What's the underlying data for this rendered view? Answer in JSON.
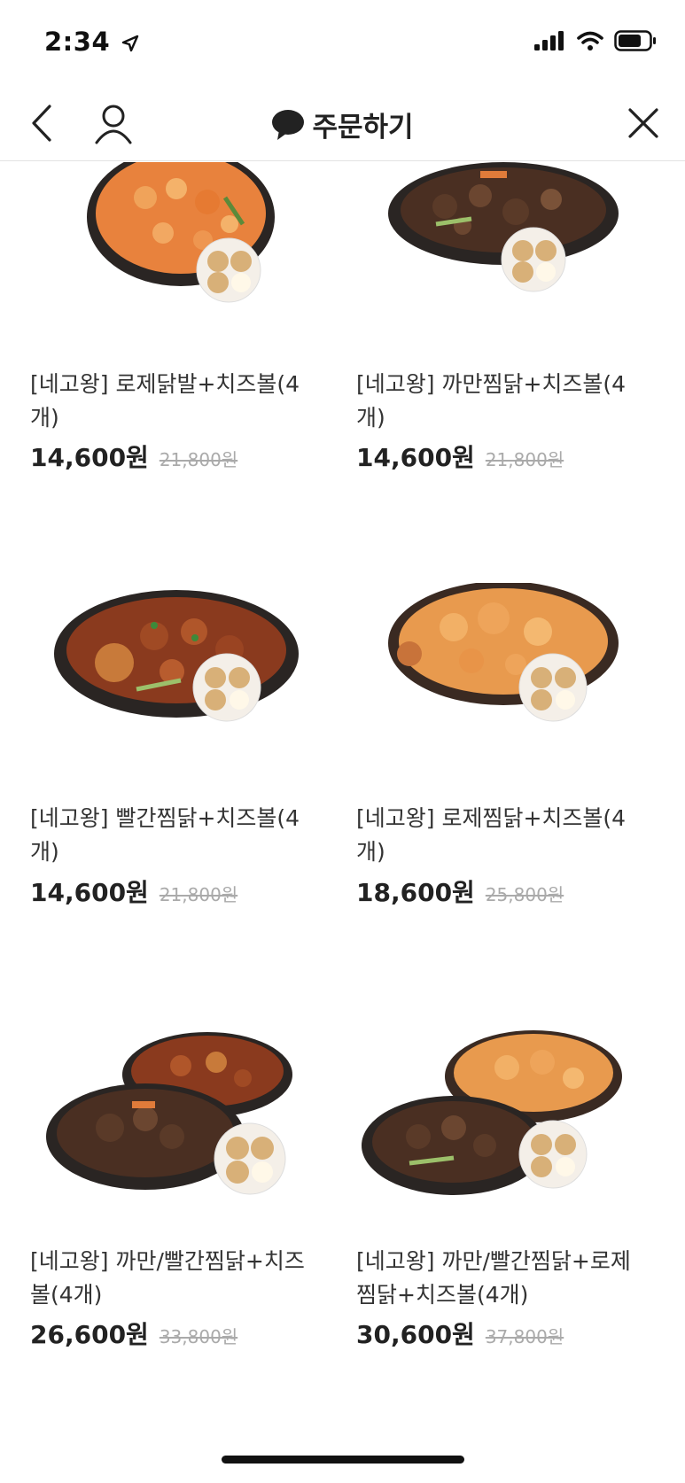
{
  "status": {
    "time": "2:34"
  },
  "nav": {
    "title": "주문하기"
  },
  "products": [
    {
      "name": "[네고왕] 로제닭발+치즈볼(4개)",
      "price": "14,600원",
      "original_price": "21,800원"
    },
    {
      "name": "[네고왕] 까만찜닭+치즈볼(4개)",
      "price": "14,600원",
      "original_price": "21,800원"
    },
    {
      "name": "[네고왕] 빨간찜닭+치즈볼(4개)",
      "price": "14,600원",
      "original_price": "21,800원"
    },
    {
      "name": "[네고왕] 로제찜닭+치즈볼(4개)",
      "price": "18,600원",
      "original_price": "25,800원"
    },
    {
      "name": "[네고왕] 까만/빨간찜닭+치즈볼(4개)",
      "price": "26,600원",
      "original_price": "33,800원"
    },
    {
      "name": "[네고왕] 까만/빨간찜닭+로제찜닭+치즈볼(4개)",
      "price": "30,600원",
      "original_price": "37,800원"
    }
  ],
  "colors": {
    "rose": "#e8823d",
    "dark": "#4a2f22",
    "red": "#8a3a1e",
    "plate": "#2a2523",
    "accent": "#111111"
  },
  "icons": [
    "back-chevron-icon",
    "user-icon",
    "chat-bubble-icon",
    "close-icon",
    "cellular-signal-icon",
    "wifi-icon",
    "battery-icon",
    "location-arrow-icon"
  ]
}
